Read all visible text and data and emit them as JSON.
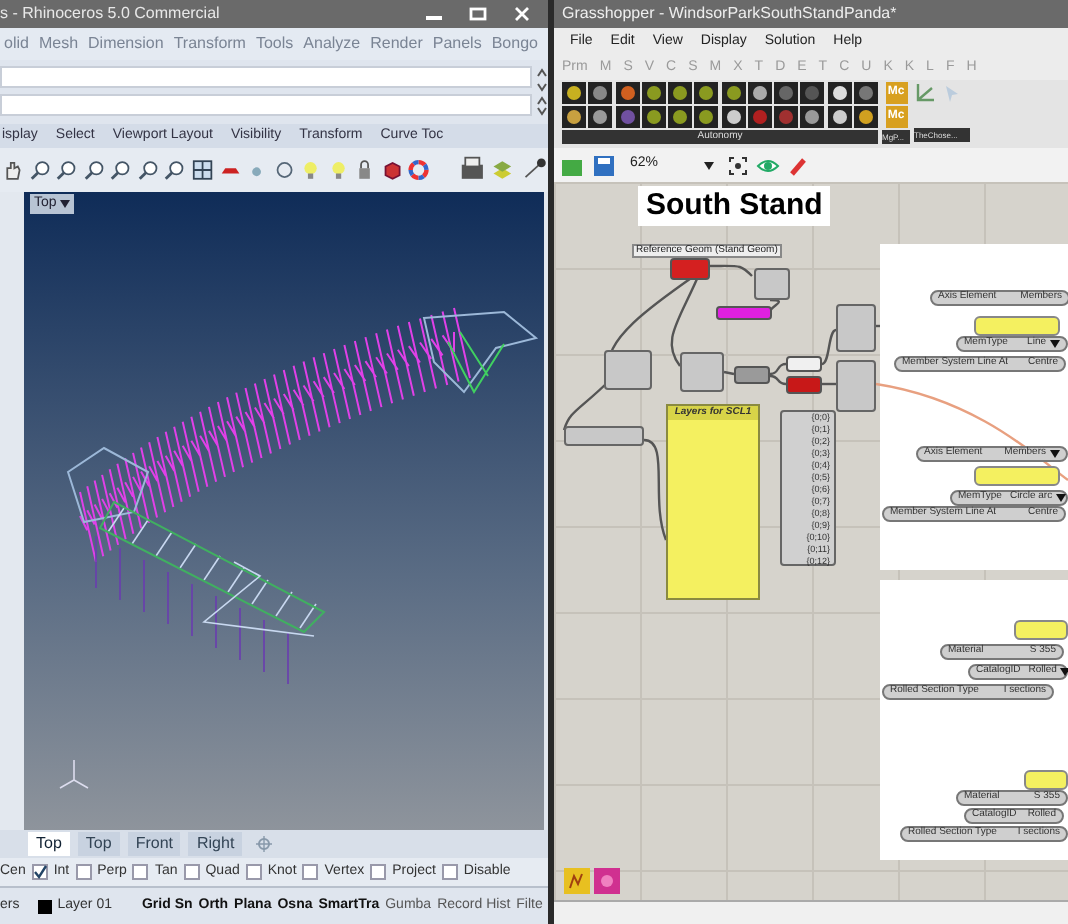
{
  "rhino": {
    "title": "s - Rhinoceros 5.0 Commercial",
    "menu": [
      "olid",
      "Mesh",
      "Dimension",
      "Transform",
      "Tools",
      "Analyze",
      "Render",
      "Panels",
      "Bongo"
    ],
    "toolbar_tabs": [
      "isplay",
      "Select",
      "Viewport Layout",
      "Visibility",
      "Transform",
      "Curve Toc"
    ],
    "viewport": {
      "label": "Top"
    },
    "viewport_tabs": [
      {
        "label": "Top",
        "selected": true
      },
      {
        "label": "Top",
        "selected": false
      },
      {
        "label": "Front",
        "selected": false
      },
      {
        "label": "Right",
        "selected": false
      }
    ],
    "osnap_cut_label": "Cen",
    "osnaps": [
      {
        "label": "Int",
        "checked": true
      },
      {
        "label": "Perp",
        "checked": false
      },
      {
        "label": "Tan",
        "checked": false
      },
      {
        "label": "Quad",
        "checked": false
      },
      {
        "label": "Knot",
        "checked": false
      },
      {
        "label": "Vertex",
        "checked": false
      },
      {
        "label": "Project",
        "checked": false
      },
      {
        "label": "Disable",
        "checked": false
      }
    ],
    "status_bar": {
      "cut_label": "ers",
      "layer": "Layer 01",
      "toggles": [
        {
          "label": "Grid Sn",
          "on": true
        },
        {
          "label": "Orth",
          "on": true
        },
        {
          "label": "Plana",
          "on": true
        },
        {
          "label": "Osna",
          "on": true
        },
        {
          "label": "SmartTra",
          "on": true
        },
        {
          "label": "Gumba",
          "on": false
        },
        {
          "label": "Record Hist",
          "on": false
        },
        {
          "label": "Filte",
          "on": false
        }
      ]
    }
  },
  "grasshopper": {
    "title": "Grasshopper - WindsorParkSouthStandPanda*",
    "menu": [
      "File",
      "Edit",
      "View",
      "Display",
      "Solution",
      "Help"
    ],
    "tabs": [
      "Prm",
      "M",
      "S",
      "V",
      "C",
      "S",
      "M",
      "X",
      "T",
      "D",
      "E",
      "T",
      "C",
      "U",
      "K",
      "K",
      "L",
      "F",
      "H"
    ],
    "tile_labels": [
      "Mc",
      "Mc"
    ],
    "panel_groups": [
      "Autonomy",
      "MgP...",
      "TheChose..."
    ],
    "zoom": "62%",
    "canvas": {
      "title": "South Stand",
      "nodes": [
        {
          "kind": "caption",
          "text": "Reference Geom (Stand Geom)"
        },
        {
          "kind": "param",
          "color": "#d42020"
        },
        {
          "kind": "component"
        },
        {
          "kind": "param",
          "color": "#e020e0"
        },
        {
          "kind": "component"
        },
        {
          "kind": "component"
        },
        {
          "kind": "param",
          "color": "#9a9a9a"
        },
        {
          "kind": "param",
          "color": "#f0f0f0"
        },
        {
          "kind": "param",
          "color": "#c81818"
        },
        {
          "kind": "component"
        },
        {
          "kind": "component"
        },
        {
          "kind": "component"
        },
        {
          "kind": "panel",
          "title": "Layers for SCL1"
        },
        {
          "kind": "outputs",
          "items": [
            "{0;0}",
            "{0;1}",
            "{0;2}",
            "{0;3}",
            "{0;4}",
            "{0;5}",
            "{0;6}",
            "{0;7}",
            "{0;8}",
            "{0;9}",
            "{0;10}",
            "{0;11}",
            "{0;12}"
          ]
        },
        {
          "kind": "pill",
          "name": "Axis Element",
          "value": "Members",
          "dropdown": false
        },
        {
          "kind": "yellow"
        },
        {
          "kind": "pill",
          "name": "MemType",
          "value": "Line",
          "dropdown": true
        },
        {
          "kind": "pill",
          "name": "Member System Line At",
          "value": "Centre",
          "dropdown": false
        },
        {
          "kind": "pill",
          "name": "Axis Element",
          "value": "Members",
          "dropdown": true
        },
        {
          "kind": "yellow"
        },
        {
          "kind": "pill",
          "name": "MemType",
          "value": "Circle arc",
          "dropdown": true
        },
        {
          "kind": "pill",
          "name": "Member System Line At",
          "value": "Centre",
          "dropdown": false
        },
        {
          "kind": "yellow"
        },
        {
          "kind": "pill",
          "name": "Material",
          "value": "S 355",
          "dropdown": false
        },
        {
          "kind": "pill",
          "name": "CatalogID",
          "value": "Rolled",
          "dropdown": true
        },
        {
          "kind": "pill",
          "name": "Rolled Section Type",
          "value": "I sections",
          "dropdown": false
        },
        {
          "kind": "yellow"
        },
        {
          "kind": "pill",
          "name": "Material",
          "value": "S 355",
          "dropdown": false
        },
        {
          "kind": "pill",
          "name": "CatalogID",
          "value": "Rolled",
          "dropdown": false
        },
        {
          "kind": "pill",
          "name": "Rolled Section Type",
          "value": "I sections",
          "dropdown": false
        }
      ]
    }
  }
}
